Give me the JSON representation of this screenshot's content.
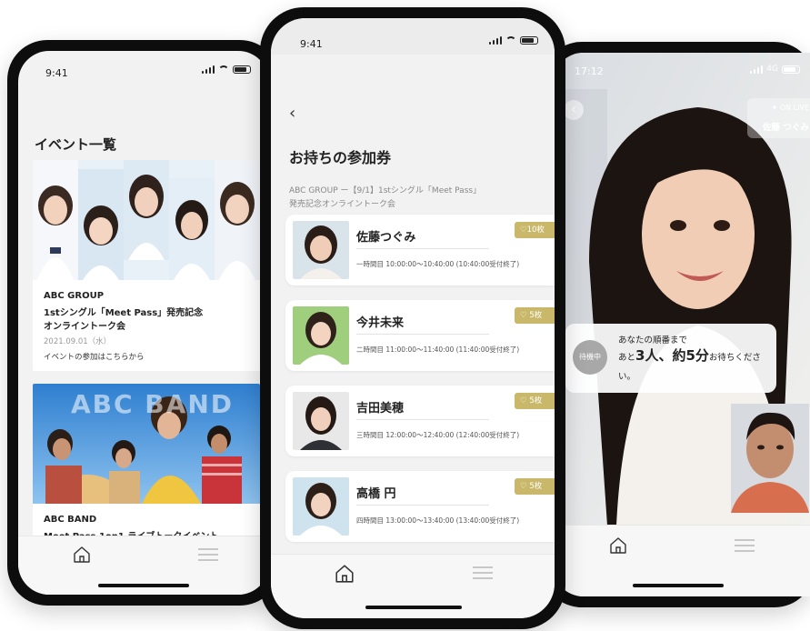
{
  "left_phone": {
    "status_time": "9:41",
    "page_title": "イベント一覧",
    "events": [
      {
        "group": "ABC GROUP",
        "title_line1": "1stシングル「Meet Pass」発売記念",
        "title_line2": "オンライントーク会",
        "date": "2021.09.01（水）",
        "link": "イベントの参加はこちらから"
      },
      {
        "group": "ABC BAND",
        "title_line1": "Meet Pass 1on1 ライブトークイベント",
        "banner_text": "ABC BAND"
      }
    ]
  },
  "center_phone": {
    "status_time": "9:41",
    "back": "‹",
    "page_title": "お持ちの参加券",
    "event_line1": "ABC GROUP ー【9/1】1stシングル「Meet Pass」",
    "event_line2": "発売記念オンライントーク会",
    "tickets": [
      {
        "name": "佐藤つぐみ",
        "count": "♡10枚",
        "slot": "一時間目  10:00:00〜10:40:00 (10:40:00受付終了)",
        "highlight": true
      },
      {
        "name": "今井未来",
        "count": "♡ 5枚",
        "slot": "二時間目  11:00:00〜11:40:00 (11:40:00受付終了)",
        "highlight": false
      },
      {
        "name": "吉田美穂",
        "count": "♡ 5枚",
        "slot": "三時間目  12:00:00〜12:40:00 (12:40:00受付終了)",
        "highlight": false
      },
      {
        "name": "高橋 円",
        "count": "♡ 5枚",
        "slot": "四時間目  13:00:00〜13:40:00 (13:40:00受付終了)",
        "highlight": false
      }
    ]
  },
  "right_phone": {
    "status_time": "17:12",
    "network": "4G",
    "live_badge": "ON LIVE",
    "performer": "佐藤 つぐみ",
    "waiting_badge": "待機中",
    "queue_line1": "あなたの順番まで",
    "queue_pre": "あと",
    "queue_count": "3人",
    "queue_mid": "、約",
    "queue_time": "5分",
    "queue_post": "お待ちくださ",
    "queue_line3": "い。"
  },
  "colors": {
    "accent_gold": "#c9b86a",
    "screen_bg": "#f2f2f2",
    "tab_bg": "#f7f7f7"
  },
  "icons": [
    "home-icon",
    "list-icon",
    "back-icon",
    "heart-icon",
    "signal-icon",
    "wifi-icon",
    "battery-icon"
  ]
}
